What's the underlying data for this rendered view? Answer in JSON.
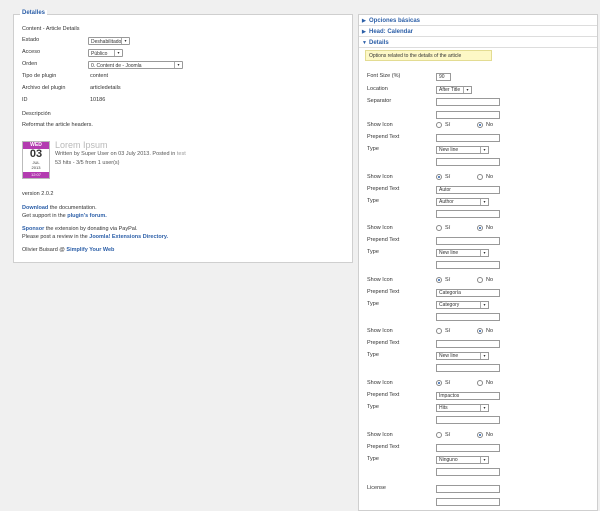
{
  "left_panel": {
    "legend": "Detalles",
    "plugin_name": "Content - Article Details",
    "fields": [
      {
        "label": "Estado",
        "value": "Deshabilitado"
      },
      {
        "label": "Acceso",
        "value": "Público"
      },
      {
        "label": "Orden",
        "value": "0. Content de - Joomla"
      },
      {
        "label": "Tipo de plugin",
        "value": "content"
      },
      {
        "label": "Archivo del plugin",
        "value": "articledetails"
      },
      {
        "label": "ID",
        "value": "10186"
      }
    ],
    "description_label": "Descripción",
    "description_text": "Reformat the article headers.",
    "preview": {
      "title": "Lorem Ipsum",
      "line1": "Written by Super User on 03 July 2013. Posted in",
      "line1_link": "test",
      "line2": "53 hits - 3/5 from 1 user(s)",
      "cal_weekday": "WED",
      "cal_day": "03",
      "cal_month": "JUL",
      "cal_year": "2013",
      "cal_time": "12:07"
    },
    "version": "version 2.0.2",
    "doc_prefix": "Download",
    "doc_text": "the documentation.",
    "support_text": "Get support in the",
    "support_link": "plugin's forum.",
    "sponsor_prefix": "Sponsor",
    "sponsor_text": "the extension by donating via PayPal.",
    "review_text": "Please post a review in the",
    "review_link": "Joomla! Extensions Directory.",
    "author": "Olivier Buisard @",
    "author_link": "Simplify Your Web"
  },
  "right_panel": {
    "sections": [
      {
        "label": "Opciones básicas",
        "expanded": false
      },
      {
        "label": "Head: Calendar",
        "expanded": false
      },
      {
        "label": "Details",
        "expanded": true
      }
    ],
    "note": "Options related to the details of the article",
    "font_size_label": "Font Size (%)",
    "font_size_value": "90",
    "location_label": "Location",
    "location_value": "After Title",
    "separator_label": "Separator",
    "radio_yes": "Sí",
    "radio_no": "No",
    "show_icon_label": "Show Icon",
    "prepend_label": "Prepend Text",
    "type_label": "Type",
    "groups": [
      {
        "show_icon": "no",
        "prepend": "",
        "type": "New line"
      },
      {
        "show_icon": "yes",
        "prepend": "Autor",
        "type": "Author"
      },
      {
        "show_icon": "no",
        "prepend": "",
        "type": "New line"
      },
      {
        "show_icon": "yes",
        "prepend": "Categoría",
        "type": "Category"
      },
      {
        "show_icon": "no",
        "prepend": "",
        "type": "New line"
      },
      {
        "show_icon": "yes",
        "prepend": "Impactos",
        "type": "Hits"
      },
      {
        "show_icon": "no",
        "prepend": "",
        "type": "Ninguno"
      }
    ],
    "license_label": "License"
  },
  "colors": {
    "link": "#2c5fa8",
    "calendar": "#b33bb0",
    "note_bg": "#fdf8c6"
  }
}
